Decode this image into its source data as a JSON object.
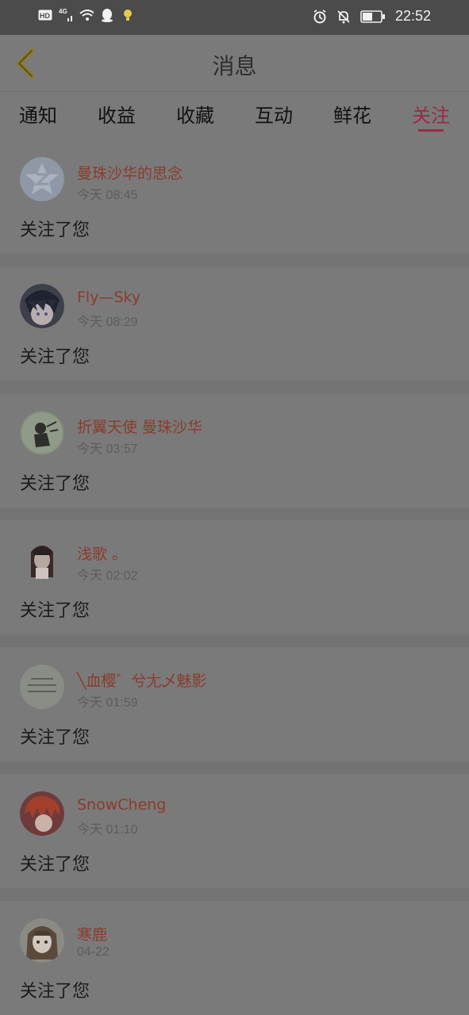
{
  "status_bar": {
    "left_icons": [
      "hd-icon",
      "4g-signal-icon",
      "wifi-icon",
      "qq-icon",
      "bulb-icon"
    ],
    "right_icons": [
      "alarm-icon",
      "mute-bell-icon",
      "battery-icon"
    ],
    "time": "22:52"
  },
  "header": {
    "title": "消息",
    "back_icon": "back-chevron-icon"
  },
  "tabs": [
    {
      "label": "通知",
      "active": false
    },
    {
      "label": "收益",
      "active": false
    },
    {
      "label": "收藏",
      "active": false
    },
    {
      "label": "互动",
      "active": false
    },
    {
      "label": "鲜花",
      "active": false
    },
    {
      "label": "关注",
      "active": true
    }
  ],
  "colors": {
    "accent": "#9a2947",
    "name": "#8b3b2b",
    "background": "#7a7a7a"
  },
  "notifications": [
    {
      "name": "曼珠沙华的思念",
      "time": "今天 08:45",
      "message": "关注了您"
    },
    {
      "name": "Fly—Sky",
      "time": "今天 08:29",
      "message": "关注了您"
    },
    {
      "name": "折翼天使 曼珠沙华",
      "time": "今天 03:57",
      "message": "关注了您"
    },
    {
      "name": "浅歌 。",
      "time": "今天 02:02",
      "message": "关注了您"
    },
    {
      "name": "╲血樱゛兮尢乄魅影",
      "time": "今天 01:59",
      "message": "关注了您"
    },
    {
      "name": "SnowCheng",
      "time": "今天 01:10",
      "message": "关注了您"
    },
    {
      "name": "寒鹿",
      "time": "04-22",
      "message": "关注了您"
    }
  ]
}
